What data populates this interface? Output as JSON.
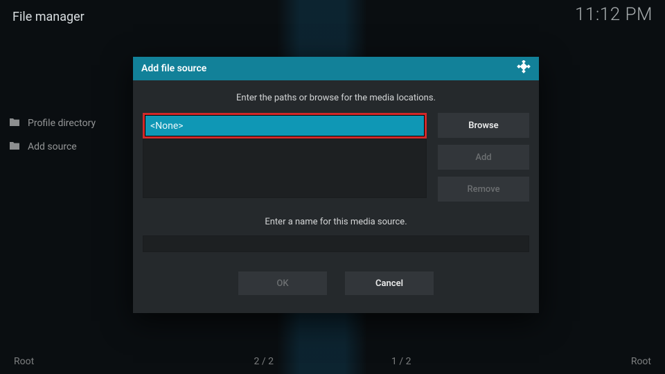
{
  "header": {
    "title": "File manager",
    "clock": "11:12 PM"
  },
  "sidebar": {
    "items": [
      {
        "icon": "folder-icon",
        "label": "Profile directory"
      },
      {
        "icon": "folder-icon",
        "label": "Add source"
      }
    ]
  },
  "footer": {
    "left": "Root",
    "center_left": "2 / 2",
    "center_right": "1 / 2",
    "right": "Root"
  },
  "dialog": {
    "title": "Add file source",
    "instruction_paths": "Enter the paths or browse for the media locations.",
    "path_value": "<None>",
    "buttons": {
      "browse": "Browse",
      "add": "Add",
      "remove": "Remove"
    },
    "instruction_name": "Enter a name for this media source.",
    "name_value": "",
    "ok": "OK",
    "cancel": "Cancel"
  }
}
